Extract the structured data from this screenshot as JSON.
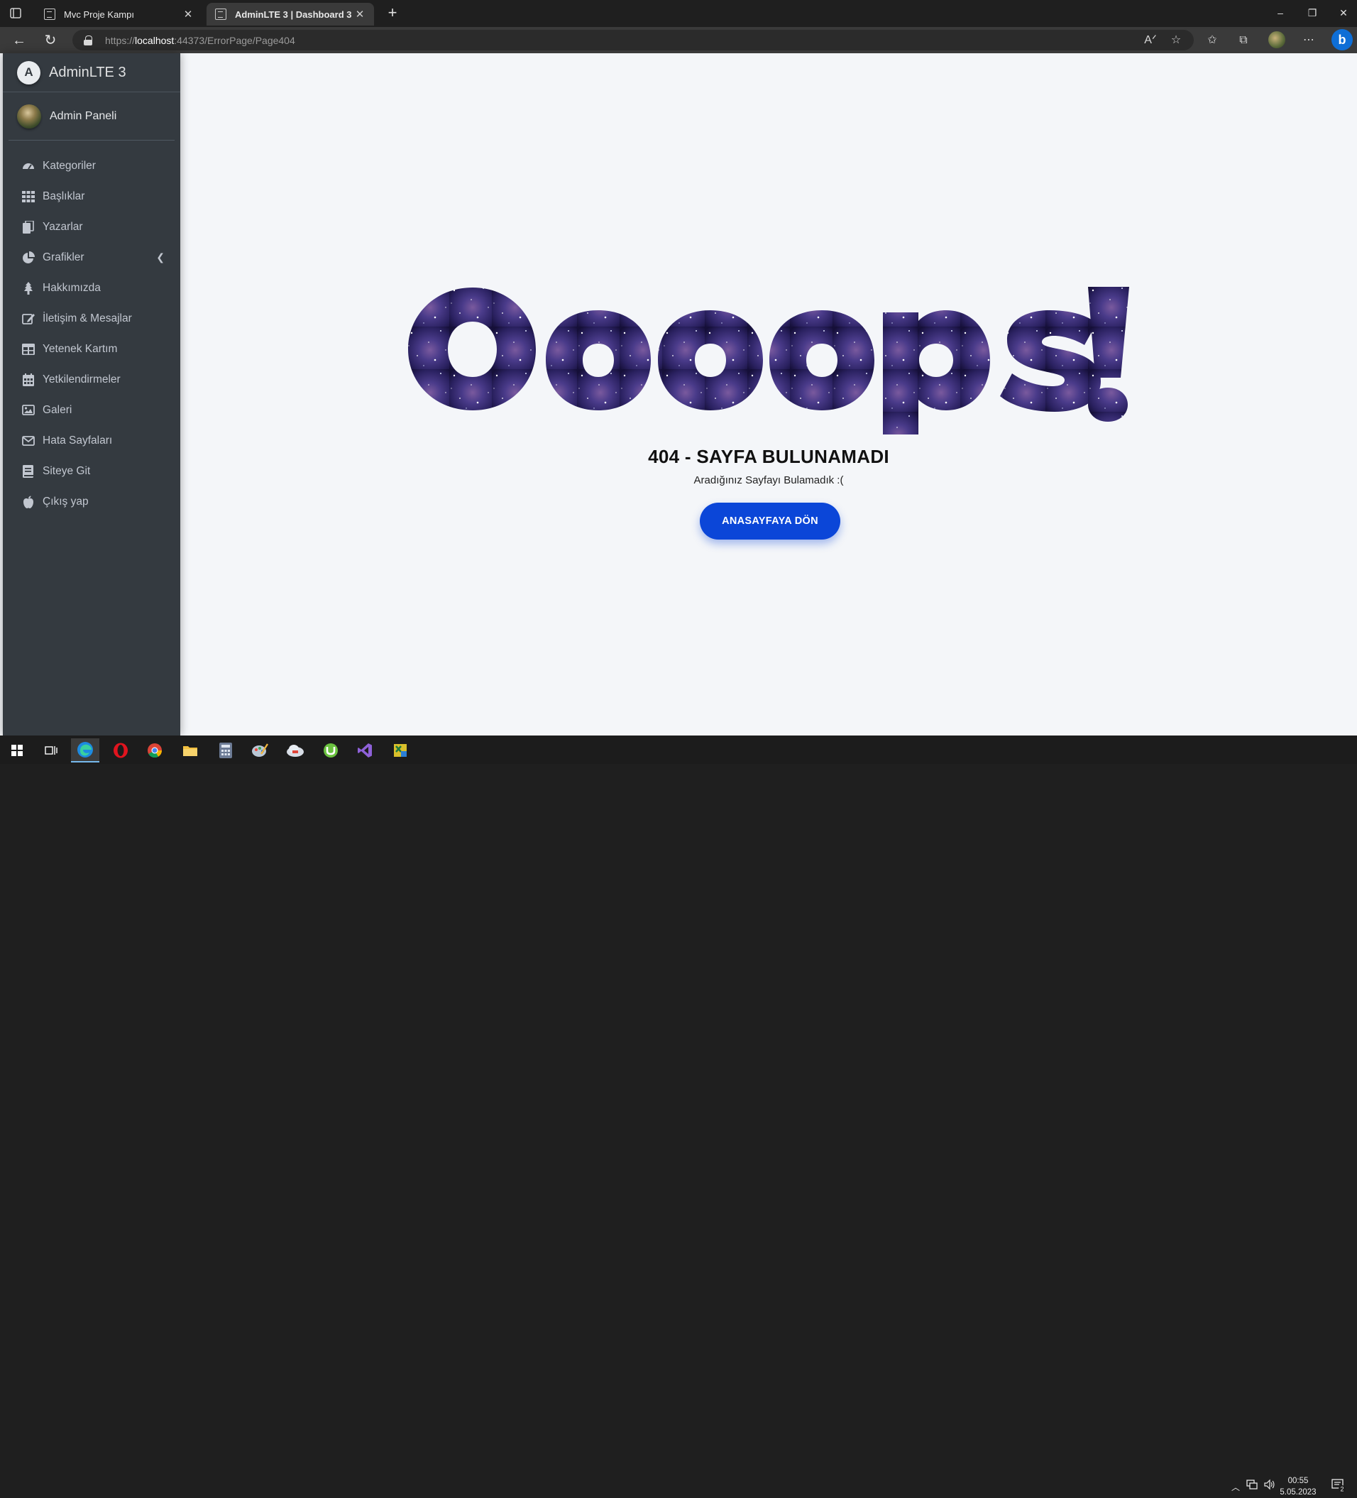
{
  "browser": {
    "tabs": [
      {
        "label": "Mvc Proje Kampı",
        "active": false
      },
      {
        "label": "AdminLTE 3 | Dashboard 3",
        "active": true
      }
    ],
    "url": {
      "protocol": "https://",
      "host": "localhost",
      "path": ":44373/ErrorPage/Page404"
    }
  },
  "sidebar": {
    "brand": "AdminLTE 3",
    "user": "Admin Paneli",
    "items": [
      {
        "label": "Kategoriler",
        "icon": "tachometer-icon"
      },
      {
        "label": "Başlıklar",
        "icon": "grid-icon"
      },
      {
        "label": "Yazarlar",
        "icon": "copy-icon"
      },
      {
        "label": "Grafikler",
        "icon": "pie-chart-icon"
      },
      {
        "label": "Hakkımızda",
        "icon": "tree-icon"
      },
      {
        "label": "İletişim & Mesajlar",
        "icon": "edit-icon"
      },
      {
        "label": "Yetenek Kartım",
        "icon": "table-icon"
      },
      {
        "label": "Yetkilendirmeler",
        "icon": "calendar-icon"
      },
      {
        "label": "Galeri",
        "icon": "image-icon"
      },
      {
        "label": "Hata Sayfaları",
        "icon": "envelope-icon"
      },
      {
        "label": "Siteye Git",
        "icon": "book-icon"
      },
      {
        "label": "Çıkış yap",
        "icon": "apple-icon"
      }
    ]
  },
  "error": {
    "big_text": "Ooops!",
    "title": "404 - SAYFA BULUNAMADI",
    "subtitle": "Aradığınız Sayfayı Bulamadık :(",
    "button": "ANASAYFAYA DÖN"
  },
  "taskbar": {
    "time": "00:55",
    "date": "5.05.2023",
    "notifications": "2"
  },
  "colors": {
    "sidebar_bg": "#343a40",
    "content_bg": "#f4f6f9",
    "button_bg": "#0b46d8",
    "ooops_fill": "#2a2160"
  }
}
